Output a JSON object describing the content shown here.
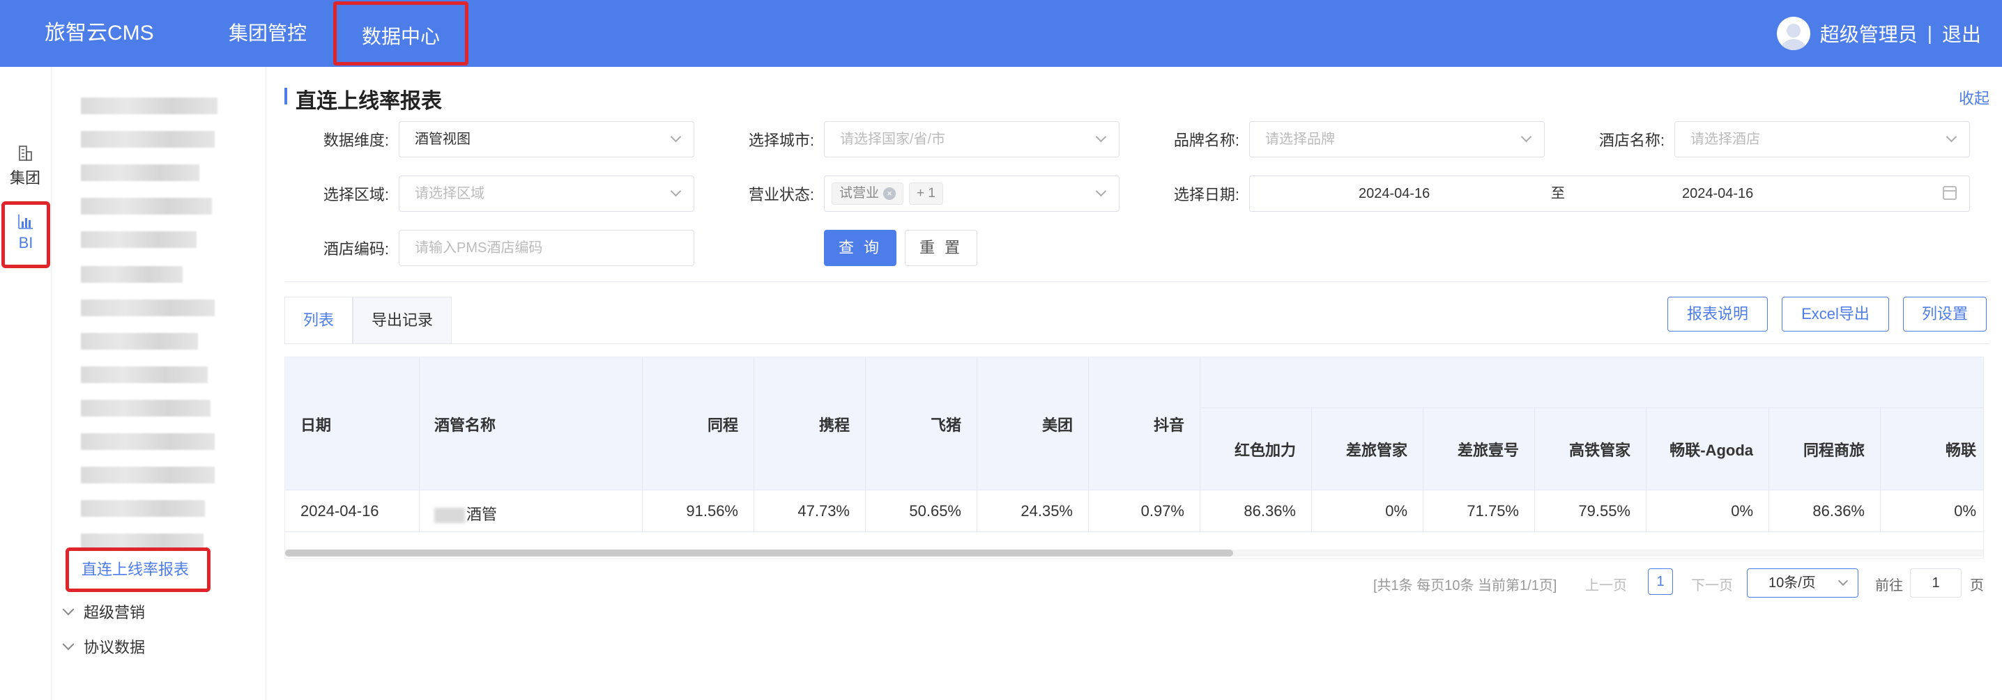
{
  "topbar": {
    "brand": "旅智云CMS",
    "nav": [
      "集团管控",
      "数据中心"
    ],
    "user_name": "超级管理员",
    "separator": "|",
    "logout": "退出"
  },
  "rail": {
    "items": [
      {
        "label": "集团",
        "icon": "building-icon"
      },
      {
        "label": "BI",
        "icon": "bar-chart-icon"
      }
    ]
  },
  "sidebar": {
    "active_item": "直连上线率报表",
    "groups": [
      "超级营销",
      "协议数据"
    ]
  },
  "page": {
    "title": "直连上线率报表",
    "collapse": "收起"
  },
  "filters": {
    "dimension_label": "数据维度:",
    "dimension_value": "酒管视图",
    "city_label": "选择城市:",
    "city_placeholder": "请选择国家/省/市",
    "brand_label": "品牌名称:",
    "brand_placeholder": "请选择品牌",
    "hotel_label": "酒店名称:",
    "hotel_placeholder": "请选择酒店",
    "area_label": "选择区域:",
    "area_placeholder": "请选择区域",
    "status_label": "营业状态:",
    "status_tag": "试营业",
    "status_more": "+ 1",
    "date_label": "选择日期:",
    "date_from": "2024-04-16",
    "date_to_sep": "至",
    "date_to": "2024-04-16",
    "code_label": "酒店编码:",
    "code_placeholder": "请输入PMS酒店编码",
    "query": "查 询",
    "reset": "重 置"
  },
  "tabs": [
    "列表",
    "导出记录"
  ],
  "actions": [
    "报表说明",
    "Excel导出",
    "列设置"
  ],
  "table": {
    "headers": [
      "日期",
      "酒管名称",
      "同程",
      "携程",
      "飞猪",
      "美团",
      "抖音",
      "红色加力",
      "差旅管家",
      "差旅壹号",
      "高铁管家",
      "畅联-Agoda",
      "同程商旅",
      "畅联"
    ],
    "rows": [
      [
        "2024-04-16",
        "酒管",
        "91.56%",
        "47.73%",
        "50.65%",
        "24.35%",
        "0.97%",
        "86.36%",
        "0%",
        "71.75%",
        "79.55%",
        "0%",
        "86.36%",
        "0%"
      ]
    ]
  },
  "pagination": {
    "summary": "[共1条 每页10条 当前第1/1页]",
    "prev": "上一页",
    "current": "1",
    "next": "下一页",
    "page_size": "10条/页",
    "goto_label": "前往",
    "goto_value": "1",
    "page_unit": "页"
  },
  "colors": {
    "primary": "#4d7de9",
    "highlight_border": "#e0242b",
    "header_band": "#f0f4fd"
  }
}
